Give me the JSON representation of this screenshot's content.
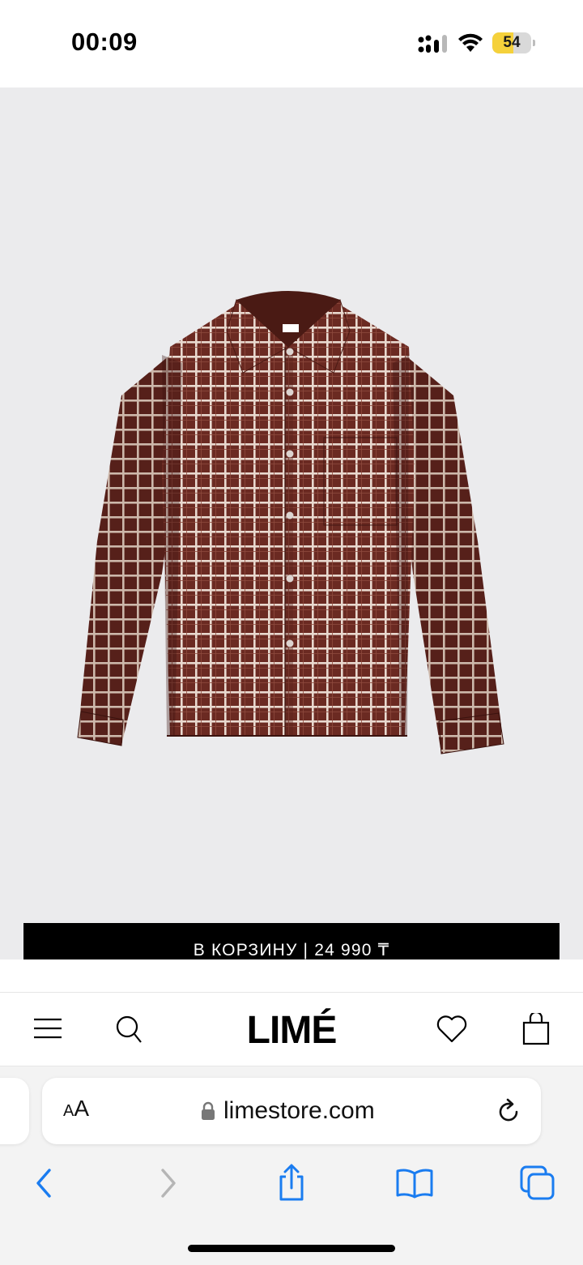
{
  "status_bar": {
    "time": "00:09",
    "battery_level": "54",
    "battery_fraction": 0.54,
    "signal": "signal-icon",
    "wifi": "wifi-icon"
  },
  "product": {
    "image_description_icon": "checked-shirt-image",
    "add_to_cart_label": "В КОРЗИНУ  |  24 990 ₸"
  },
  "header": {
    "menu_icon": "menu-icon",
    "search_icon": "search-icon",
    "logo": "LIMÉ",
    "wishlist_icon": "heart-icon",
    "bag_icon": "shopping-bag-icon"
  },
  "browser": {
    "text_size_label_large": "A",
    "text_size_label_small": "A",
    "url": "limestore.com",
    "lock_icon": "lock-icon",
    "reload_icon": "reload-icon"
  },
  "toolbar": {
    "back": "back-icon",
    "forward": "forward-icon",
    "share": "share-icon",
    "bookmarks": "bookmarks-icon",
    "tabs": "tabs-icon"
  },
  "colors": {
    "accent": "#1a7cf0",
    "button_bg": "#000000",
    "image_bg": "#ebebed",
    "shirt": "#6b2a22",
    "battery": "#f5d13b"
  }
}
